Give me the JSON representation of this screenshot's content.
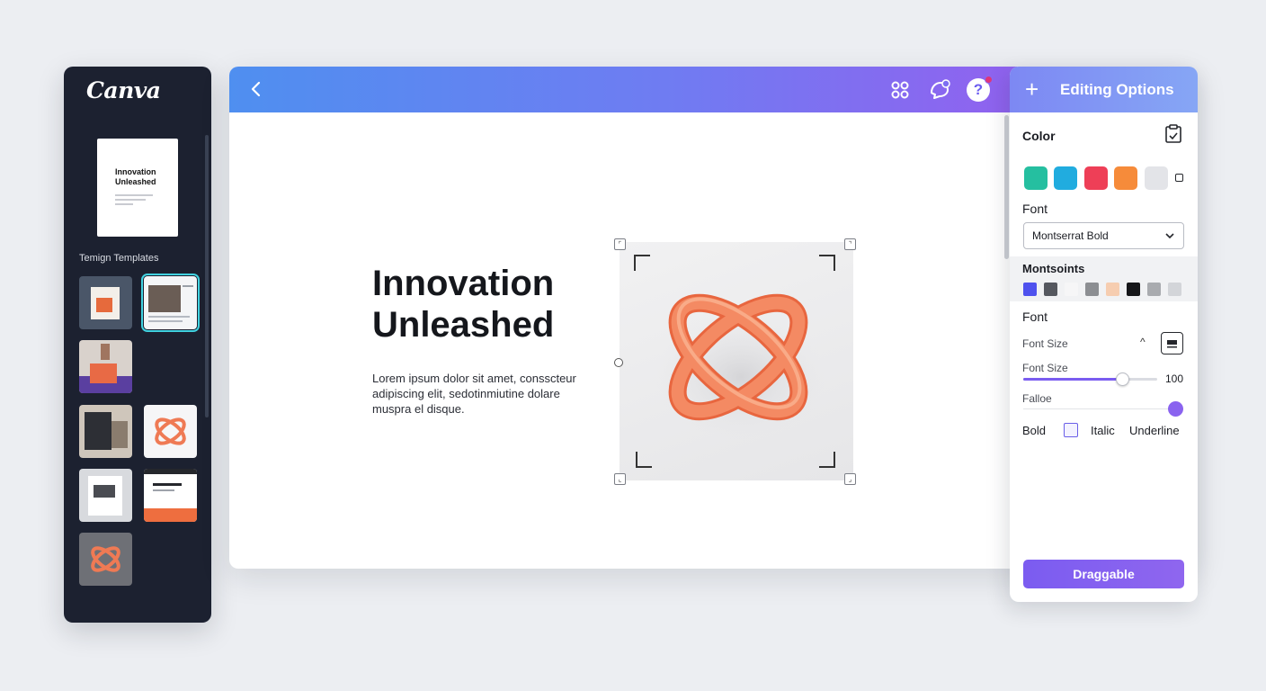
{
  "app": {
    "logo": "Canva"
  },
  "sidebar": {
    "doc_thumbnail": {
      "title_line1": "Innovation",
      "title_line2": "Unleashed"
    },
    "templates_label": "Temign Templates"
  },
  "canvas": {
    "headline": [
      "Innovation",
      "Unleashed"
    ],
    "body": [
      "Lorem ipsum dolor sit amet, consscteur",
      "adipiscing elit, sedotinmiutine dolare",
      "muspra el disque."
    ]
  },
  "panel": {
    "title": "Editing Options",
    "color_label": "Color",
    "colors": [
      "#25bfa0",
      "#21acdf",
      "#ee3f57",
      "#f68b3a",
      "#e3e4e8"
    ],
    "font_label": "Font",
    "font_value": "Montserrat Bold",
    "mont_label": "Montsoints",
    "mini_colors": [
      "#4f52ee",
      "#55585f",
      "#f6f6f7",
      "#8c8e92",
      "#f6cdb0",
      "#16171a",
      "#a9abaf",
      "#d3d5d9"
    ],
    "font_label_2": "Font",
    "font_size_label_1": "Font Size",
    "font_size_label_2": "Font Size",
    "font_size_value": "100",
    "font_size_fraction": 0.74,
    "falloe_label": "Falloe",
    "style_bold": "Bold",
    "style_italic": "Italic",
    "style_underline": "Underline",
    "drag_button": "Draggable"
  }
}
